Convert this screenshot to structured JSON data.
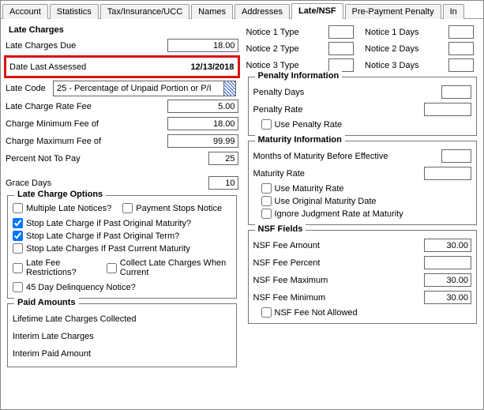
{
  "tabs": {
    "account": "Account",
    "statistics": "Statistics",
    "tax": "Tax/Insurance/UCC",
    "names": "Names",
    "addresses": "Addresses",
    "late_nsf": "Late/NSF",
    "prepay": "Pre-Payment Penalty",
    "in": "In"
  },
  "late_charges": {
    "title": "Late Charges",
    "due_label": "Late Charges Due",
    "due_value": "18.00",
    "date_assessed_label": "Date Last Assessed",
    "date_assessed_value": "12/13/2018",
    "late_code_label": "Late Code",
    "late_code_value": "25 - Percentage of Unpaid Portion or P/I",
    "rate_fee_label": "Late Charge Rate Fee",
    "rate_fee_value": "5.00",
    "min_fee_label": "Charge Minimum Fee of",
    "min_fee_value": "18.00",
    "max_fee_label": "Charge Maximum Fee of",
    "max_fee_value": "99.99",
    "percent_not_pay_label": "Percent Not To Pay",
    "percent_not_pay_value": "25",
    "grace_days_label": "Grace Days",
    "grace_days_value": "10"
  },
  "late_options": {
    "legend": "Late Charge Options",
    "multiple_late_notices": "Multiple Late Notices?",
    "payment_stops_notice": "Payment Stops Notice",
    "stop_past_original_maturity": "Stop Late Charge if Past Original Maturity?",
    "stop_past_original_term": "Stop Late Charge if Past Original Term?",
    "stop_past_current_maturity": "Stop Late Charges If Past Current Maturity",
    "late_fee_restrictions": "Late Fee Restrictions?",
    "collect_when_current": "Collect Late Charges When Current",
    "forty_five_day_notice": "45 Day Delinquency Notice?"
  },
  "paid_amounts": {
    "legend": "Paid Amounts",
    "lifetime_collected": "Lifetime Late Charges Collected",
    "interim_late": "Interim Late Charges",
    "interim_paid": "Interim Paid Amount"
  },
  "notices": {
    "n1_type": "Notice 1 Type",
    "n1_days": "Notice 1 Days",
    "n2_type": "Notice 2 Type",
    "n2_days": "Notice 2 Days",
    "n3_type": "Notice 3 Type",
    "n3_days": "Notice 3 Days"
  },
  "penalty": {
    "legend": "Penalty Information",
    "days_label": "Penalty Days",
    "rate_label": "Penalty Rate",
    "use_rate": "Use Penalty Rate"
  },
  "maturity": {
    "legend": "Maturity Information",
    "months_before": "Months of Maturity Before Effective",
    "rate_label": "Maturity Rate",
    "use_rate": "Use Maturity Rate",
    "use_original_date": "Use Original Maturity Date",
    "ignore_judgment": "Ignore Judgment Rate at Maturity"
  },
  "nsf": {
    "legend": "NSF Fields",
    "fee_amount_label": "NSF Fee Amount",
    "fee_amount_value": "30.00",
    "fee_percent_label": "NSF Fee Percent",
    "fee_percent_value": "",
    "fee_max_label": "NSF Fee Maximum",
    "fee_max_value": "30.00",
    "fee_min_label": "NSF Fee Minimum",
    "fee_min_value": "30.00",
    "not_allowed": "NSF Fee Not Allowed"
  }
}
